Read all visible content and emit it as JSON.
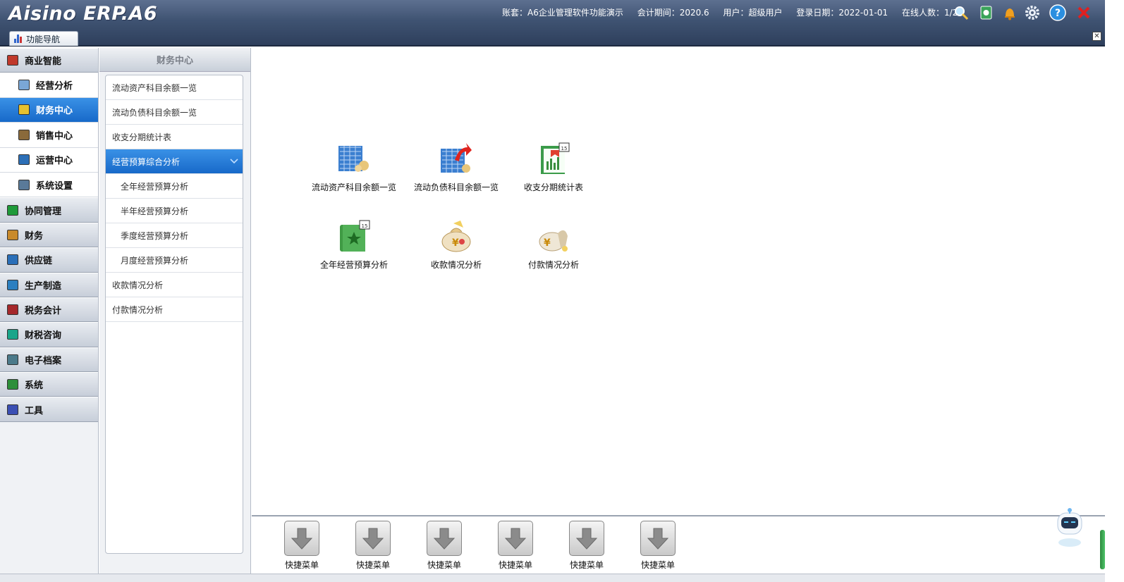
{
  "app": {
    "logo_text": "Aisino ERP.A6"
  },
  "header": {
    "account_label": "账套：A6企业管理软件功能演示",
    "period_label": "会计期间：2020.6",
    "user_label": "用户：超级用户",
    "login_date_label": "登录日期：2022-01-01",
    "online_label": "在线人数：1/2",
    "icons": [
      "search-icon",
      "notebook-icon",
      "bell-icon",
      "gear-icon",
      "help-icon",
      "close-icon"
    ]
  },
  "tabs": {
    "nav_label": "功能导航"
  },
  "sidebar": {
    "items": [
      {
        "label": "商业智能",
        "kind": "category",
        "color": "#c0392b"
      },
      {
        "label": "经营分析",
        "kind": "sub",
        "color": "#7aa7d6"
      },
      {
        "label": "财务中心",
        "kind": "sub",
        "active": true,
        "color": "#e6c12f"
      },
      {
        "label": "销售中心",
        "kind": "sub",
        "color": "#8a6a3b"
      },
      {
        "label": "运营中心",
        "kind": "sub",
        "color": "#2c6fb7"
      },
      {
        "label": "系统设置",
        "kind": "sub",
        "color": "#5a7a99"
      },
      {
        "label": "协同管理",
        "kind": "category",
        "color": "#1f9a3a"
      },
      {
        "label": "财务",
        "kind": "category",
        "color": "#c98a2b"
      },
      {
        "label": "供应链",
        "kind": "category",
        "color": "#2a6fb8"
      },
      {
        "label": "生产制造",
        "kind": "category",
        "color": "#2b7fc0"
      },
      {
        "label": "税务会计",
        "kind": "category",
        "color": "#a5282b"
      },
      {
        "label": "财税咨询",
        "kind": "category",
        "color": "#1aa58a"
      },
      {
        "label": "电子档案",
        "kind": "category",
        "color": "#4c7a8a"
      },
      {
        "label": "系统",
        "kind": "category",
        "color": "#2e8f3a"
      },
      {
        "label": "工具",
        "kind": "category",
        "color": "#3b4fb3"
      }
    ]
  },
  "middle": {
    "title": "财务中心",
    "items": [
      {
        "label": "流动资产科目余额一览",
        "level": 1
      },
      {
        "label": "流动负债科目余额一览",
        "level": 1
      },
      {
        "label": "收支分期统计表",
        "level": 1
      },
      {
        "label": "经营预算综合分析",
        "level": 1,
        "selected": true
      },
      {
        "label": "全年经营预算分析",
        "level": 2
      },
      {
        "label": "半年经营预算分析",
        "level": 2
      },
      {
        "label": "季度经营预算分析",
        "level": 2
      },
      {
        "label": "月度经营预算分析",
        "level": 2
      },
      {
        "label": "收款情况分析",
        "level": 1
      },
      {
        "label": "付款情况分析",
        "level": 1
      }
    ]
  },
  "main": {
    "apps": [
      {
        "label": "流动资产科目余额一览",
        "icon": "asset-balance-icon"
      },
      {
        "label": "流动负债科目余额一览",
        "icon": "liability-balance-icon"
      },
      {
        "label": "收支分期统计表",
        "icon": "statistics-report-icon"
      },
      {
        "label": "全年经营预算分析",
        "icon": "annual-budget-icon"
      },
      {
        "label": "收款情况分析",
        "icon": "receipt-analysis-icon"
      },
      {
        "label": "付款情况分析",
        "icon": "payment-analysis-icon"
      }
    ]
  },
  "quickmenu": {
    "items": [
      "快捷菜单",
      "快捷菜单",
      "快捷菜单",
      "快捷菜单",
      "快捷菜单",
      "快捷菜单"
    ]
  }
}
